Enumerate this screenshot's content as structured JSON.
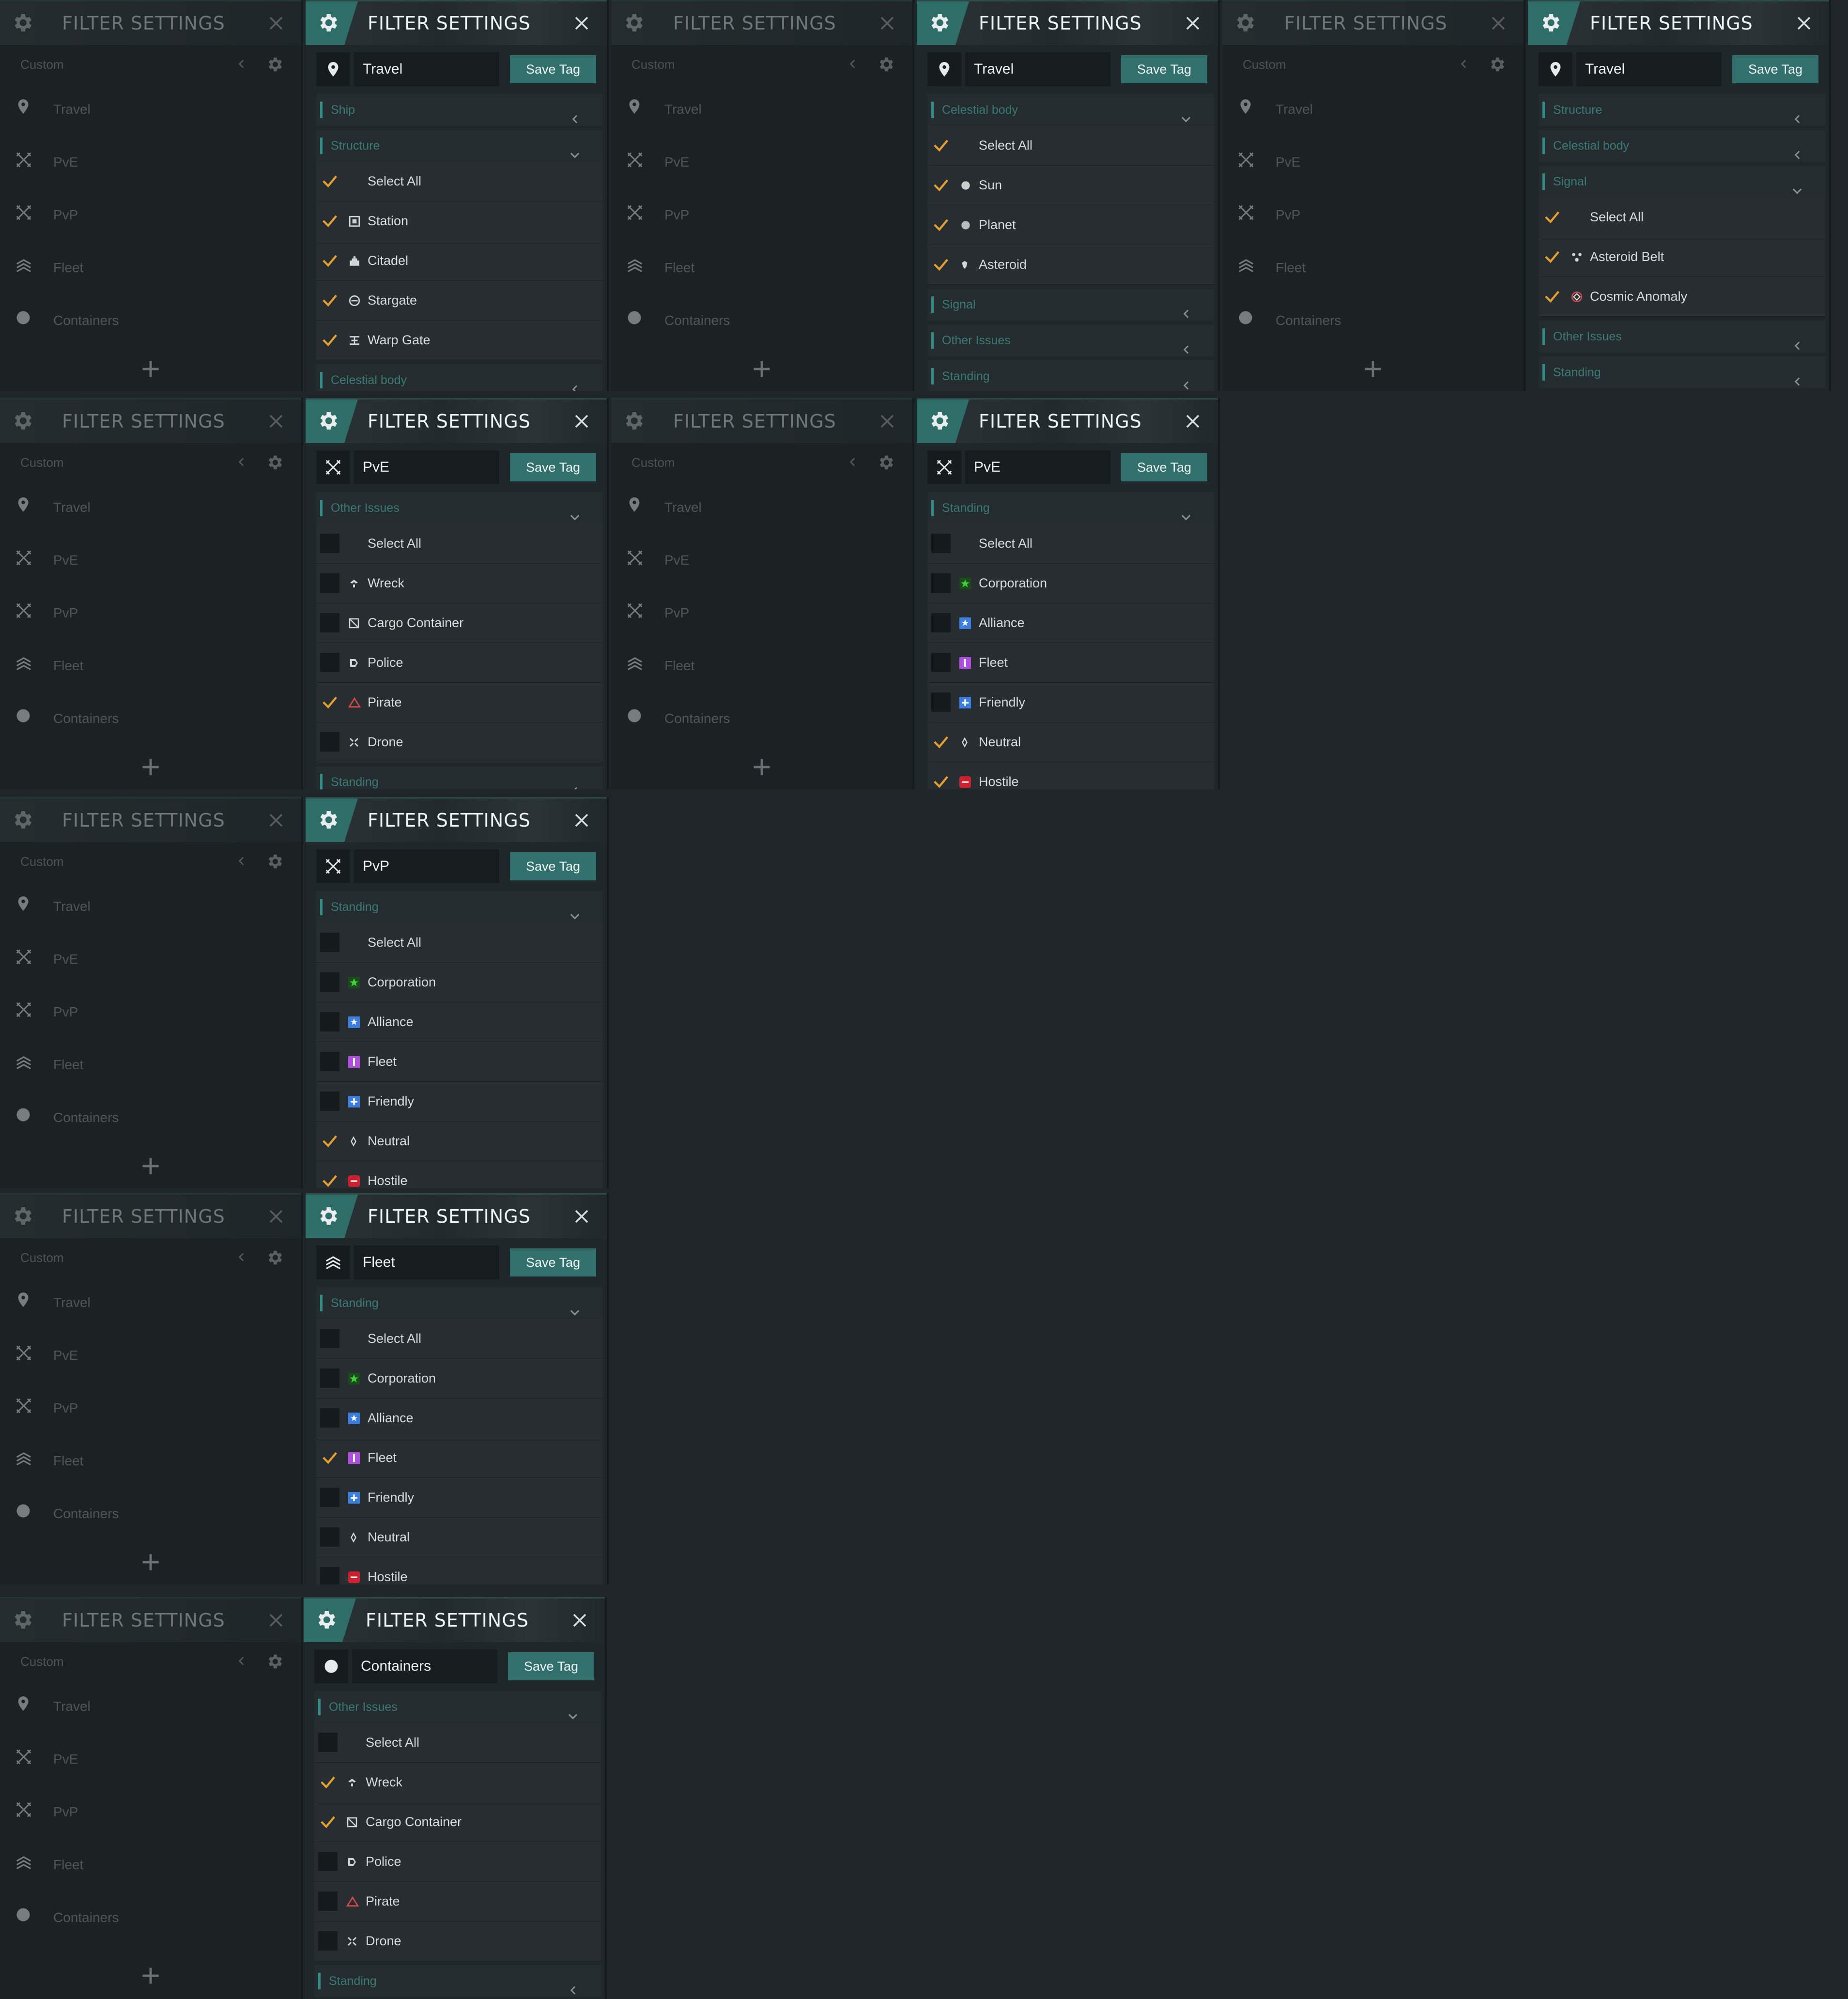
{
  "colors": {
    "accent": "#2e6d68",
    "check": "#e2a030",
    "section_text": "#3b7a74",
    "corporation": "#3fcf3f",
    "alliance": "#3a7fe0",
    "fleet": "#b04de0",
    "friendly": "#3a7fe0",
    "hostile": "#d02030",
    "pirate": "#d04a4a"
  },
  "ui": {
    "title": "FILTER SETTINGS",
    "save_label": "Save Tag",
    "custom_label": "Custom",
    "nav": [
      "Travel",
      "PvE",
      "PvP",
      "Fleet",
      "Containers"
    ]
  },
  "panels": [
    {
      "tag": "Travel",
      "icon": "pin-icon",
      "sections": [
        {
          "label": "Ship",
          "open": false
        },
        {
          "label": "Structure",
          "open": true,
          "rows": [
            {
              "label": "Select All",
              "checked": true,
              "icon": ""
            },
            {
              "label": "Station",
              "checked": true,
              "icon": "station-icon"
            },
            {
              "label": "Citadel",
              "checked": true,
              "icon": "citadel-icon"
            },
            {
              "label": "Stargate",
              "checked": true,
              "icon": "stargate-icon"
            },
            {
              "label": "Warp Gate",
              "checked": true,
              "icon": "warp-gate-icon"
            }
          ]
        },
        {
          "label": "Celestial body",
          "open": false
        }
      ]
    },
    {
      "tag": "Travel",
      "icon": "pin-icon",
      "sections": [
        {
          "label": "Celestial body",
          "open": true,
          "rows": [
            {
              "label": "Select All",
              "checked": true,
              "icon": ""
            },
            {
              "label": "Sun",
              "checked": true,
              "icon": "sun-icon"
            },
            {
              "label": "Planet",
              "checked": true,
              "icon": "planet-icon"
            },
            {
              "label": "Asteroid",
              "checked": true,
              "icon": "asteroid-icon"
            }
          ]
        },
        {
          "label": "Signal",
          "open": false
        },
        {
          "label": "Other Issues",
          "open": false
        },
        {
          "label": "Standing",
          "open": false
        }
      ]
    },
    {
      "tag": "Travel",
      "icon": "pin-icon",
      "sections": [
        {
          "label": "Structure",
          "open": false
        },
        {
          "label": "Celestial body",
          "open": false
        },
        {
          "label": "Signal",
          "open": true,
          "rows": [
            {
              "label": "Select All",
              "checked": true,
              "icon": ""
            },
            {
              "label": "Asteroid Belt",
              "checked": true,
              "icon": "asteroid-belt-icon"
            },
            {
              "label": "Cosmic Anomaly",
              "checked": true,
              "icon": "cosmic-anomaly-icon"
            }
          ]
        },
        {
          "label": "Other Issues",
          "open": false
        },
        {
          "label": "Standing",
          "open": false
        }
      ]
    },
    {
      "tag": "PvE",
      "icon": "swords-icon",
      "sections": [
        {
          "label": "Other Issues",
          "open": true,
          "rows": [
            {
              "label": "Select All",
              "checked": false,
              "icon": ""
            },
            {
              "label": "Wreck",
              "checked": false,
              "icon": "wreck-icon"
            },
            {
              "label": "Cargo Container",
              "checked": false,
              "icon": "cargo-icon"
            },
            {
              "label": "Police",
              "checked": false,
              "icon": "police-icon"
            },
            {
              "label": "Pirate",
              "checked": true,
              "icon": "pirate-icon"
            },
            {
              "label": "Drone",
              "checked": false,
              "icon": "drone-icon"
            }
          ]
        },
        {
          "label": "Standing",
          "open": false
        }
      ]
    },
    {
      "tag": "PvE",
      "icon": "swords-icon",
      "sections": [
        {
          "label": "Standing",
          "open": true,
          "rows": [
            {
              "label": "Select All",
              "checked": false,
              "icon": ""
            },
            {
              "label": "Corporation",
              "checked": false,
              "icon": "corporation-icon"
            },
            {
              "label": "Alliance",
              "checked": false,
              "icon": "alliance-icon"
            },
            {
              "label": "Fleet",
              "checked": false,
              "icon": "fleet-standing-icon"
            },
            {
              "label": "Friendly",
              "checked": false,
              "icon": "friendly-icon"
            },
            {
              "label": "Neutral",
              "checked": true,
              "icon": "neutral-icon"
            },
            {
              "label": "Hostile",
              "checked": true,
              "icon": "hostile-icon"
            }
          ]
        }
      ]
    },
    {
      "tag": "PvP",
      "icon": "swords-icon",
      "sections": [
        {
          "label": "Standing",
          "open": true,
          "rows": [
            {
              "label": "Select All",
              "checked": false,
              "icon": ""
            },
            {
              "label": "Corporation",
              "checked": false,
              "icon": "corporation-icon"
            },
            {
              "label": "Alliance",
              "checked": false,
              "icon": "alliance-icon"
            },
            {
              "label": "Fleet",
              "checked": false,
              "icon": "fleet-standing-icon"
            },
            {
              "label": "Friendly",
              "checked": false,
              "icon": "friendly-icon"
            },
            {
              "label": "Neutral",
              "checked": true,
              "icon": "neutral-icon"
            },
            {
              "label": "Hostile",
              "checked": true,
              "icon": "hostile-icon"
            }
          ]
        }
      ]
    },
    {
      "tag": "Fleet",
      "icon": "fleet-icon",
      "sections": [
        {
          "label": "Standing",
          "open": true,
          "rows": [
            {
              "label": "Select All",
              "checked": false,
              "icon": ""
            },
            {
              "label": "Corporation",
              "checked": false,
              "icon": "corporation-icon"
            },
            {
              "label": "Alliance",
              "checked": false,
              "icon": "alliance-icon"
            },
            {
              "label": "Fleet",
              "checked": true,
              "icon": "fleet-standing-icon"
            },
            {
              "label": "Friendly",
              "checked": false,
              "icon": "friendly-icon"
            },
            {
              "label": "Neutral",
              "checked": false,
              "icon": "neutral-icon"
            },
            {
              "label": "Hostile",
              "checked": false,
              "icon": "hostile-icon"
            }
          ]
        }
      ]
    },
    {
      "tag": "Containers",
      "icon": "circle-icon",
      "sections": [
        {
          "label": "Other Issues",
          "open": true,
          "rows": [
            {
              "label": "Select All",
              "checked": false,
              "icon": ""
            },
            {
              "label": "Wreck",
              "checked": true,
              "icon": "wreck-icon"
            },
            {
              "label": "Cargo Container",
              "checked": true,
              "icon": "cargo-icon"
            },
            {
              "label": "Police",
              "checked": false,
              "icon": "police-icon"
            },
            {
              "label": "Pirate",
              "checked": false,
              "icon": "pirate-icon"
            },
            {
              "label": "Drone",
              "checked": false,
              "icon": "drone-icon"
            }
          ]
        },
        {
          "label": "Standing",
          "open": false
        }
      ]
    }
  ]
}
